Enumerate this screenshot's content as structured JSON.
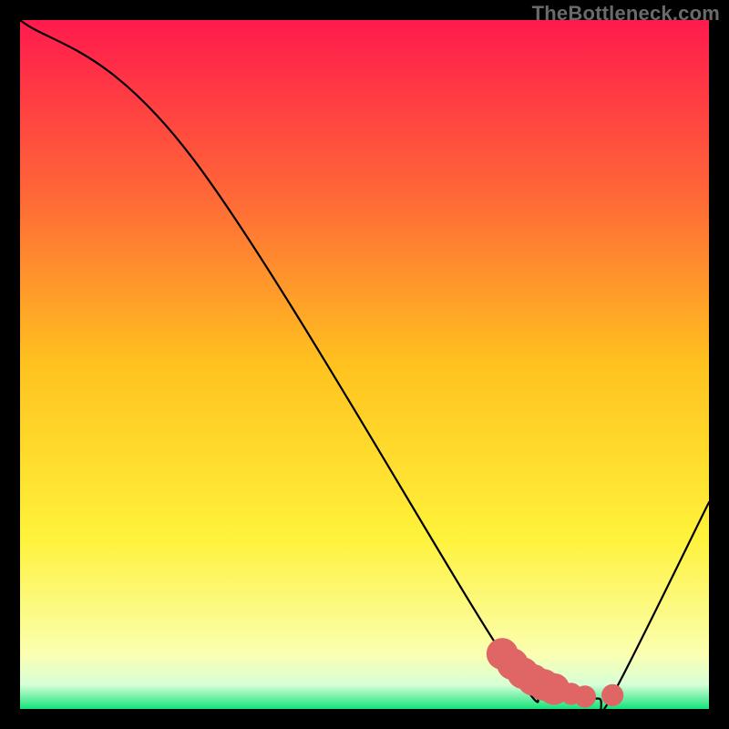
{
  "watermark": "TheBottleneck.com",
  "chart_data": {
    "type": "line",
    "title": "",
    "xlabel": "",
    "ylabel": "",
    "xlim": [
      0,
      100
    ],
    "ylim": [
      0,
      100
    ],
    "grid": false,
    "series": [
      {
        "name": "curve",
        "x": [
          0,
          25,
          70,
          75,
          80,
          84,
          86,
          100
        ],
        "values": [
          100,
          80,
          8,
          4,
          2,
          1.5,
          2,
          30
        ],
        "color": "#000000"
      }
    ],
    "markers": {
      "name": "highlight-dots",
      "color": "#e06666",
      "points": [
        {
          "x": 70.0,
          "y": 8.0,
          "r": 2.3
        },
        {
          "x": 71.5,
          "y": 6.5,
          "r": 2.3
        },
        {
          "x": 73.0,
          "y": 5.2,
          "r": 2.3
        },
        {
          "x": 74.5,
          "y": 4.2,
          "r": 2.3
        },
        {
          "x": 76.0,
          "y": 3.5,
          "r": 2.3
        },
        {
          "x": 77.5,
          "y": 2.9,
          "r": 2.3
        },
        {
          "x": 80.0,
          "y": 2.2,
          "r": 1.6
        },
        {
          "x": 82.0,
          "y": 1.8,
          "r": 1.6
        },
        {
          "x": 86.0,
          "y": 2.0,
          "r": 1.6
        }
      ]
    },
    "background_gradient_colors": [
      {
        "stop": 0.0,
        "color": "#ff1a4d"
      },
      {
        "stop": 0.25,
        "color": "#ff6638"
      },
      {
        "stop": 0.5,
        "color": "#ffc21f"
      },
      {
        "stop": 0.75,
        "color": "#fff23a"
      },
      {
        "stop": 0.92,
        "color": "#fbffb0"
      },
      {
        "stop": 0.965,
        "color": "#d7ffd7"
      },
      {
        "stop": 1.0,
        "color": "#14e37a"
      }
    ]
  }
}
